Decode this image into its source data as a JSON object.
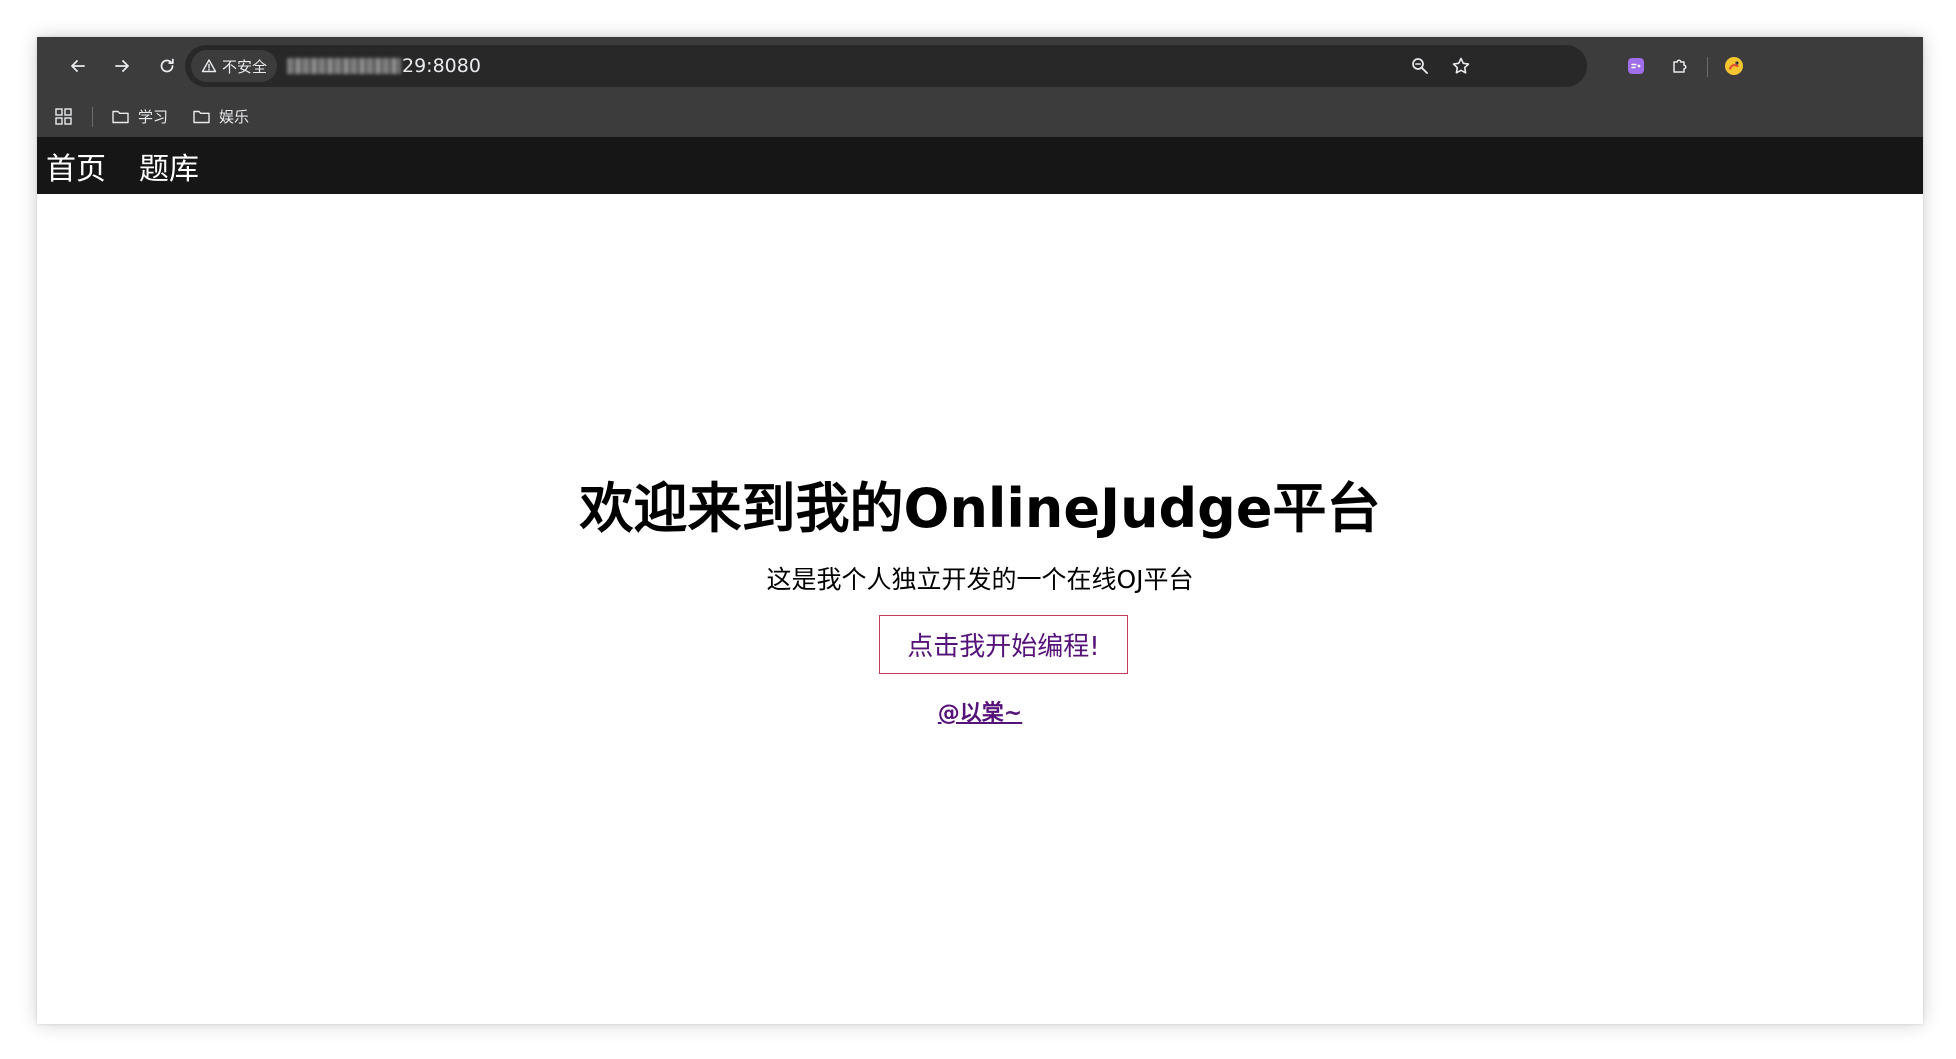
{
  "browser": {
    "security_label": "不安全",
    "url_visible": "29:8080",
    "bookmarks": [
      {
        "label": "学习",
        "icon": "folder-icon"
      },
      {
        "label": "娱乐",
        "icon": "folder-icon"
      }
    ],
    "colors": {
      "toolbar": "#3c3c3c",
      "omnibox": "#282828",
      "extension_accent": "#a06ee8",
      "avatar": "#f4c431"
    }
  },
  "site": {
    "nav": [
      {
        "label": "首页"
      },
      {
        "label": "题库"
      }
    ],
    "hero": {
      "title": "欢迎来到我的OnlineJudge平台",
      "subtitle": "这是我个人独立开发的一个在线OJ平台",
      "button_label": "点击我开始编程!",
      "author_link": "@以棠~"
    },
    "colors": {
      "navbar": "#161616",
      "link": "#55137a",
      "button_border": "#c83a5a"
    }
  }
}
